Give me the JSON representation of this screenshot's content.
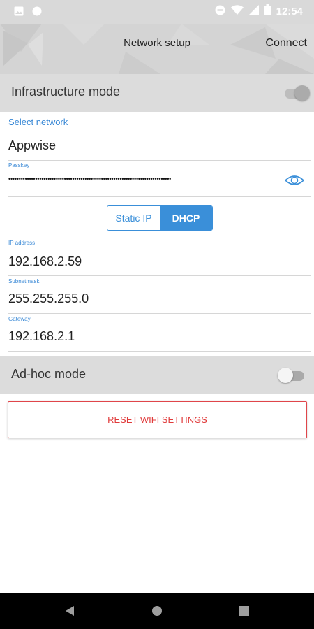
{
  "status_bar": {
    "time": "12:54",
    "left_icons": [
      "image-icon",
      "circle-icon"
    ],
    "right_icons": [
      "do-not-disturb-icon",
      "wifi-icon",
      "signal-icon",
      "battery-icon"
    ]
  },
  "app_bar": {
    "title": "Network setup",
    "connect_label": "Connect"
  },
  "infrastructure": {
    "label": "Infrastructure mode",
    "enabled": true
  },
  "network": {
    "select_label": "Select network",
    "ssid": "Appwise",
    "passkey_label": "Passkey",
    "passkey_masked": "•••••••••••••••••••••••••••••••••••••••••••••••••••••••••••••••••••••••••••••••"
  },
  "ip_mode": {
    "options": [
      "Static IP",
      "DHCP"
    ],
    "selected": "DHCP"
  },
  "ip_config": {
    "ip_label": "IP address",
    "ip_value": "192.168.2.59",
    "subnet_label": "Subnetmask",
    "subnet_value": "255.255.255.0",
    "gateway_label": "Gateway",
    "gateway_value": "192.168.2.1"
  },
  "adhoc": {
    "label": "Ad-hoc mode",
    "enabled": false
  },
  "reset_label": "RESET WIFI SETTINGS",
  "nav_bar": {
    "icons": [
      "back-icon",
      "home-icon",
      "recents-icon"
    ]
  },
  "colors": {
    "accent_blue": "#3a8fd9",
    "reset_red": "#e03a3a",
    "header_gray": "#d4d4d4",
    "section_gray": "#dcdcdc"
  }
}
